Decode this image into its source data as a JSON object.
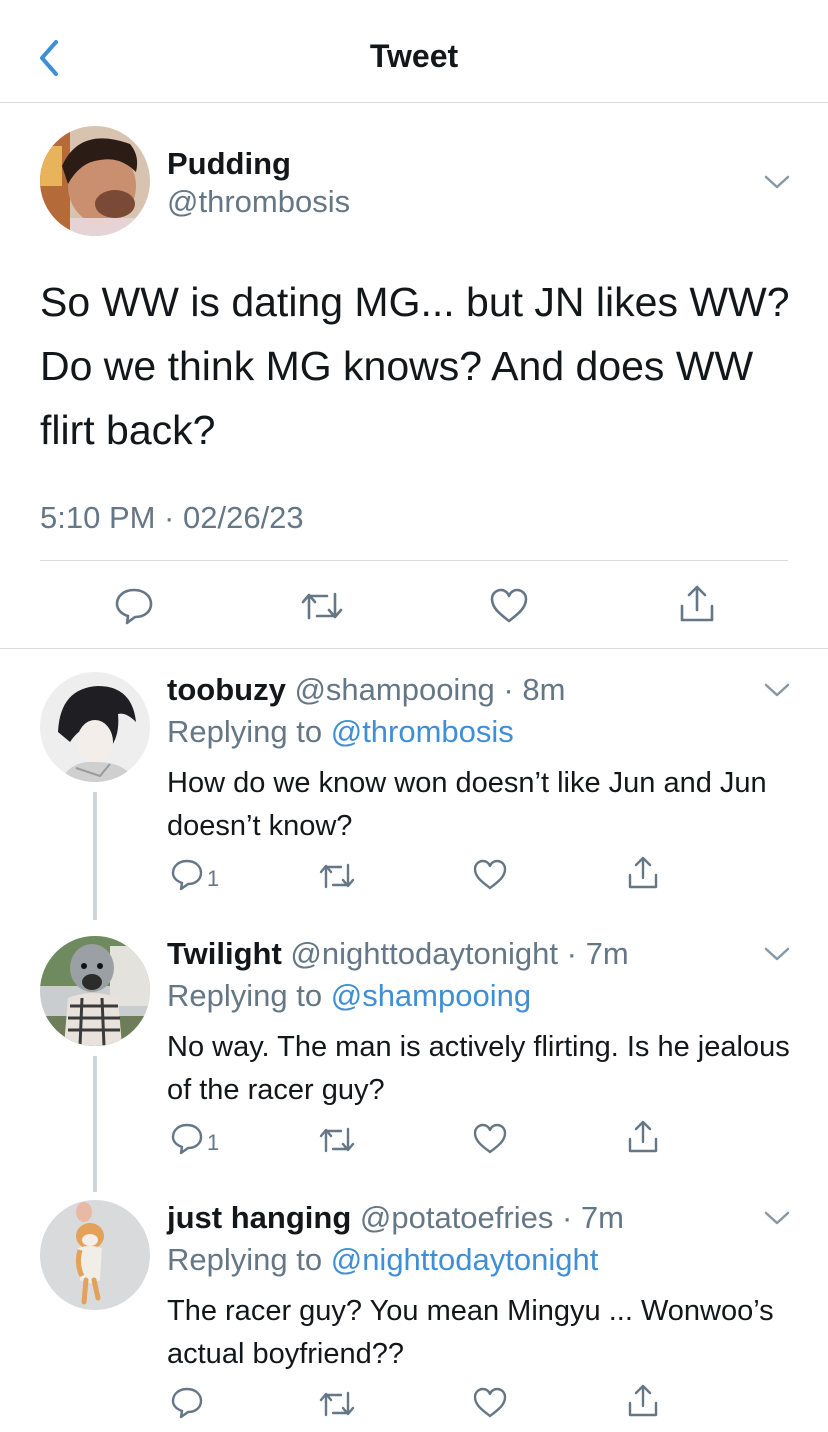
{
  "nav": {
    "title": "Tweet"
  },
  "main_tweet": {
    "name": "Pudding",
    "handle": "@thrombosis",
    "text": "So WW is dating MG... but JN likes WW? Do we think MG knows? And does WW flirt back?",
    "timestamp": "5:10 PM · 02/26/23"
  },
  "replies": [
    {
      "name": "toobuzy",
      "handle_time": "@shampooing · 8m",
      "replying_label": "Replying to",
      "replying_to": "@thrombosis",
      "text": "How do we know won doesn’t like Jun and Jun doesn’t know?",
      "reply_count": "1"
    },
    {
      "name": "Twilight",
      "handle_time": "@nighttodaytonight · 7m",
      "replying_label": "Replying to",
      "replying_to": "@shampooing",
      "text": "No way. The man is actively flirting. Is he jealous of the racer guy?",
      "reply_count": "1"
    },
    {
      "name": "just hanging",
      "handle_time": "@potatoefries · 7m",
      "replying_label": "Replying to",
      "replying_to": "@nighttodaytonight",
      "text": "The racer guy? You mean Mingyu ... Wonwoo’s actual boyfriend??",
      "reply_count": ""
    }
  ],
  "icons": {
    "back": "chevron-left-icon",
    "more": "chevron-down-icon",
    "reply": "speech-bubble-icon",
    "retweet": "retweet-icon",
    "like": "heart-icon",
    "share": "share-icon"
  },
  "colors": {
    "accent": "#3f8fd6",
    "secondary_text": "#657786",
    "primary_text": "#14171a",
    "divider": "#d9dde1"
  }
}
